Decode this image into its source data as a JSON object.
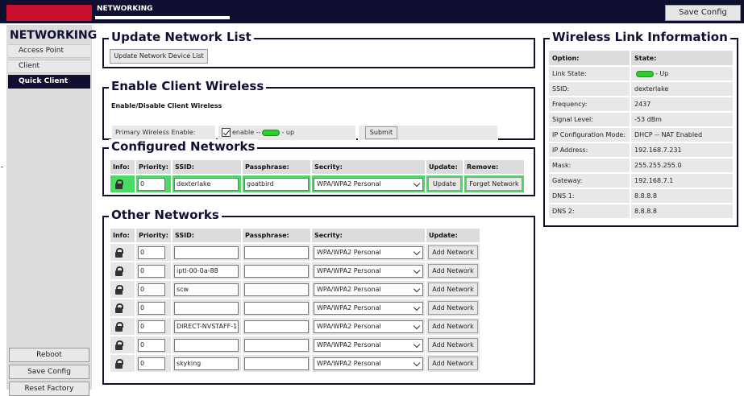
{
  "header": {
    "section": "NETWORKING",
    "save_config": "Save Config"
  },
  "sidebar": {
    "title": "NETWORKING",
    "items": [
      {
        "label": "Access Point"
      },
      {
        "label": "Client"
      },
      {
        "label": "Quick Client",
        "active": true
      }
    ],
    "buttons": {
      "reboot": "Reboot",
      "save_config": "Save Config",
      "reset_factory": "Reset Factory"
    }
  },
  "update_network_list": {
    "title": "Update Network List",
    "button": "Update Network Device List"
  },
  "enable_client_wireless": {
    "title": "Enable Client Wireless",
    "subtitle": "Enable/Disable Client Wireless",
    "row_label": "Primary Wireless Enable:",
    "checkbox_text": "enable --",
    "status_text": "- up",
    "submit": "Submit"
  },
  "configured_networks": {
    "title": "Configured Networks",
    "headers": [
      "Info:",
      "Priority:",
      "SSID:",
      "Passphrase:",
      "Secrity:",
      "Update:",
      "Remove:"
    ],
    "rows": [
      {
        "priority": "0",
        "ssid": "dexterlake",
        "passphrase": "goatbird",
        "security": "WPA/WPA2 Personal",
        "update": "Update",
        "remove": "Forget Network"
      }
    ]
  },
  "other_networks": {
    "title": "Other Networks",
    "headers": [
      "Info:",
      "Priority:",
      "SSID:",
      "Passphrase:",
      "Secrity:",
      "Update:"
    ],
    "rows": [
      {
        "priority": "0",
        "ssid": "",
        "passphrase": "",
        "security": "WPA/WPA2 Personal",
        "action": "Add Network"
      },
      {
        "priority": "0",
        "ssid": "iptl-00-0a-88",
        "passphrase": "",
        "security": "WPA/WPA2 Personal",
        "action": "Add Network"
      },
      {
        "priority": "0",
        "ssid": "scw",
        "passphrase": "",
        "security": "WPA/WPA2 Personal",
        "action": "Add Network"
      },
      {
        "priority": "0",
        "ssid": "",
        "passphrase": "",
        "security": "WPA/WPA2 Personal",
        "action": "Add Network"
      },
      {
        "priority": "0",
        "ssid": "DIRECT-NVSTAFF-1",
        "passphrase": "",
        "security": "WPA/WPA2 Personal",
        "action": "Add Network"
      },
      {
        "priority": "0",
        "ssid": "",
        "passphrase": "",
        "security": "WPA/WPA2 Personal",
        "action": "Add Network"
      },
      {
        "priority": "0",
        "ssid": "skyking",
        "passphrase": "",
        "security": "WPA/WPA2 Personal",
        "action": "Add Network"
      }
    ]
  },
  "wireless_link": {
    "title": "Wireless Link Information",
    "headers": [
      "Option:",
      "State:"
    ],
    "rows": [
      {
        "option": "Link State:",
        "state": "- Up",
        "indicator": true
      },
      {
        "option": "SSID:",
        "state": "dexterlake"
      },
      {
        "option": "Frequency:",
        "state": "2437"
      },
      {
        "option": "Signal Level:",
        "state": "-53 dBm"
      },
      {
        "option": "IP Configuration Mode:",
        "state": "DHCP -- NAT Enabled"
      },
      {
        "option": "IP Address:",
        "state": "192.168.7.231"
      },
      {
        "option": "Mask:",
        "state": "255.255.255.0"
      },
      {
        "option": "Gateway:",
        "state": "192.168.7.1"
      },
      {
        "option": "DNS 1:",
        "state": "8.8.8.8"
      },
      {
        "option": "DNS 2:",
        "state": "8.8.8.8"
      }
    ]
  },
  "colors": {
    "navy": "#0f0f2f",
    "brand_red": "#c8102e",
    "status_green": "#2fcc2f",
    "row_green": "#4cd964"
  }
}
